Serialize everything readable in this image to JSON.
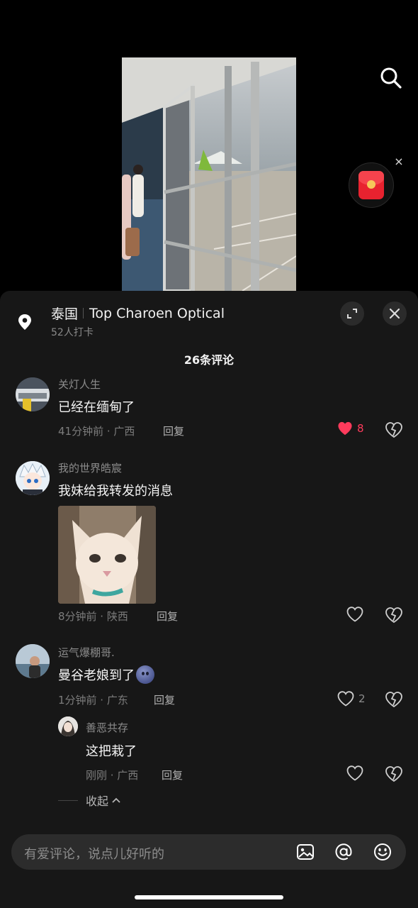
{
  "location": {
    "country": "泰国",
    "place": "Top Charoen Optical",
    "checkins": "52人打卡"
  },
  "comments_header": "26条评论",
  "comments": [
    {
      "user": "关灯人生",
      "text": "已经在缅甸了",
      "time_region": "41分钟前 · 广西",
      "reply_label": "回复",
      "likes": "8",
      "liked": true
    },
    {
      "user": "我的世界皓宸",
      "text": "我妹给我转发的消息",
      "time_region": "8分钟前 · 陕西",
      "reply_label": "回复",
      "likes": "",
      "liked": false
    },
    {
      "user": "运气爆棚哥.",
      "text": "曼谷老娘到了",
      "time_region": "1分钟前 · 广东",
      "reply_label": "回复",
      "likes": "2",
      "liked": false
    }
  ],
  "reply": {
    "user": "善恶共存",
    "text": "这把栽了",
    "time_region": "刚刚 · 广西",
    "reply_label": "回复",
    "likes": ""
  },
  "collapse_label": "收起",
  "input": {
    "placeholder": "有爱评论，说点儿好听的"
  },
  "icons": {
    "search": "search-icon",
    "red_packet": "red-packet-icon",
    "location": "location-pin-icon",
    "expand": "expand-icon",
    "close": "close-icon",
    "like": "heart-icon",
    "dislike": "broken-heart-icon",
    "image": "image-icon",
    "mention": "at-icon",
    "emoji": "emoji-icon"
  },
  "colors": {
    "liked": "#ff3b5c",
    "sheet_bg": "#171717",
    "input_bg": "#2c2c2c"
  }
}
